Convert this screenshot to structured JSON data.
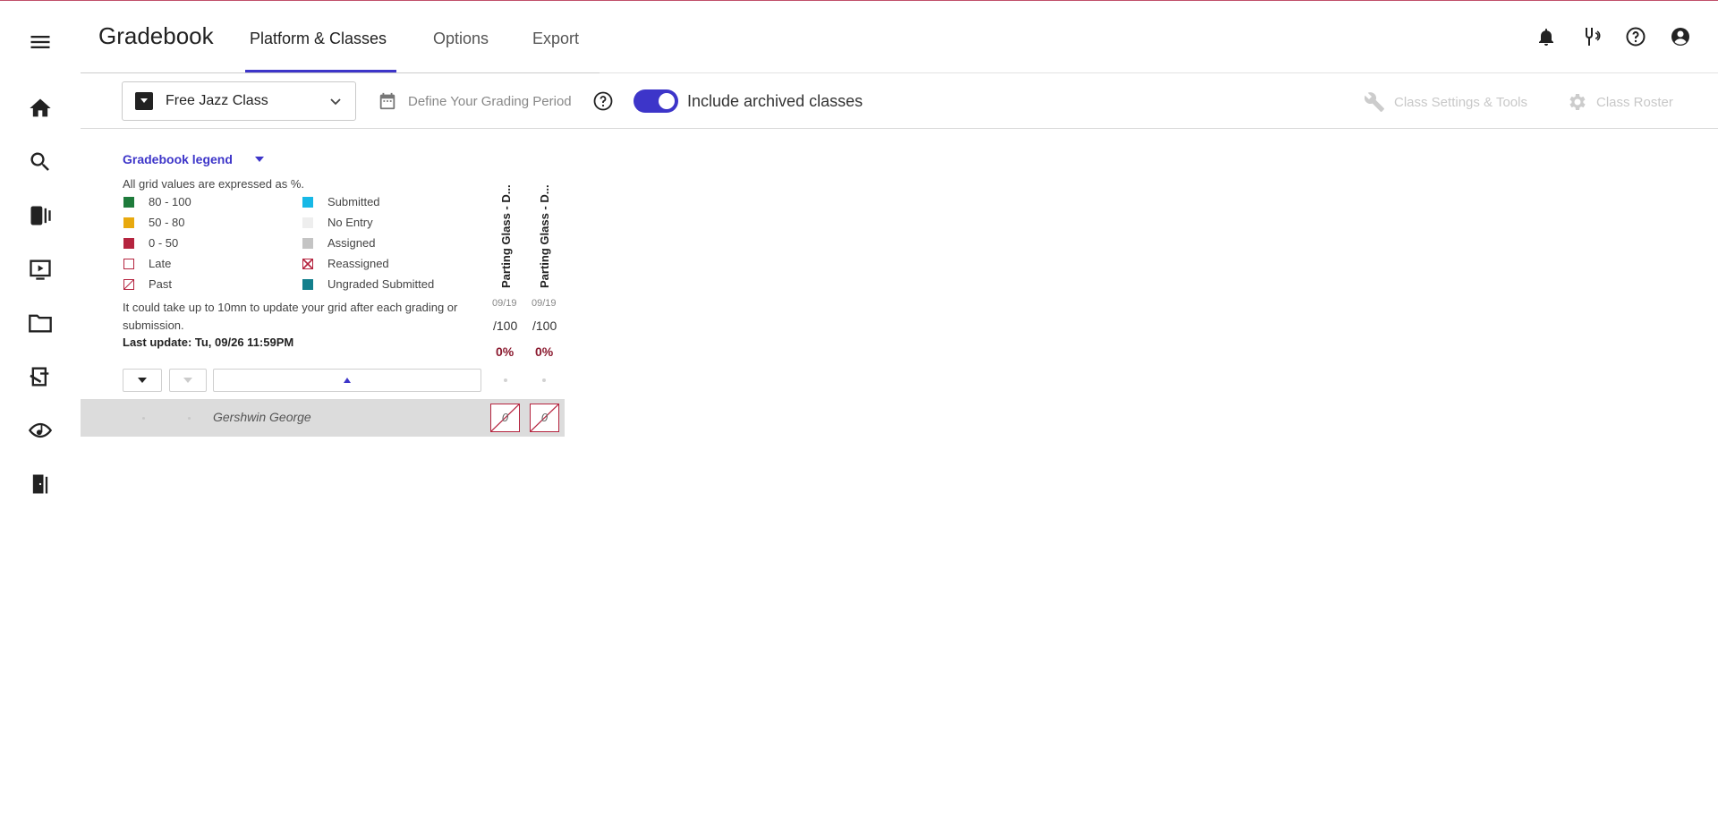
{
  "header": {
    "title": "Gradebook",
    "tabs": [
      {
        "label": "Platform & Classes"
      },
      {
        "label": "Options"
      },
      {
        "label": "Export"
      }
    ]
  },
  "toolbar": {
    "class_select_value": "Free Jazz Class",
    "grading_period_label": "Define Your Grading Period",
    "archived_toggle_on": true,
    "archived_label": "Include archived classes",
    "settings_label": "Class Settings & Tools",
    "roster_label": "Class Roster"
  },
  "legend": {
    "title": "Gradebook legend",
    "note": "All grid values are expressed as %.",
    "items": [
      {
        "label": "80 - 100",
        "color": "#1e7b3b",
        "kind": "solid"
      },
      {
        "label": "50 - 80",
        "color": "#e8a90e",
        "kind": "solid"
      },
      {
        "label": "0 - 50",
        "color": "#b5243f",
        "kind": "solid"
      },
      {
        "label": "Late",
        "color": "#b5243f",
        "kind": "outline"
      },
      {
        "label": "Past",
        "color": "#b5243f",
        "kind": "slash"
      },
      {
        "label": "Submitted",
        "color": "#17b8e6",
        "kind": "solid"
      },
      {
        "label": "No Entry",
        "color": "#eeeeee",
        "kind": "solid"
      },
      {
        "label": "Assigned",
        "color": "#c4c4c4",
        "kind": "solid"
      },
      {
        "label": "Reassigned",
        "color": "#b5243f",
        "kind": "cross"
      },
      {
        "label": "Ungraded Submitted",
        "color": "#137f8c",
        "kind": "solid"
      }
    ],
    "info": "It could take up to 10mn to update your grid after each grading or submission.",
    "last_update": "Last update: Tu, 09/26 11:59PM"
  },
  "columns": [
    {
      "title": "Parting Glass - D...",
      "date": "09/19",
      "points": "/100",
      "average": "0%"
    },
    {
      "title": "Parting Glass - D...",
      "date": "09/19",
      "points": "/100",
      "average": "0%"
    }
  ],
  "students": [
    {
      "name": "Gershwin George",
      "grades": [
        "0",
        "0"
      ]
    }
  ],
  "colors": {
    "accent": "#3d35c9",
    "danger": "#b5243f"
  }
}
